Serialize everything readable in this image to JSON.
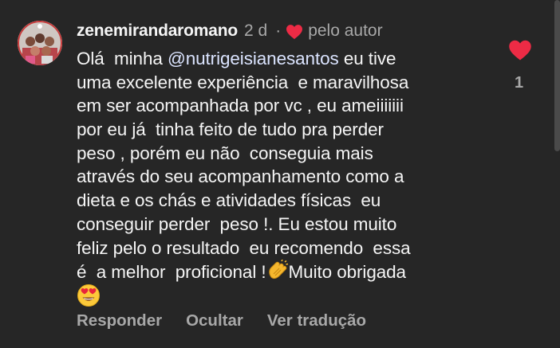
{
  "comment": {
    "username": "zenemirandaromano",
    "time_ago": "2 d",
    "separator": "·",
    "liked_by_author_label": "pelo autor",
    "mention": "@nutrigeisianesantos",
    "lines": [
      {
        "before": "Olá  minha ",
        "after": " eu tive"
      },
      {
        "text": "uma excelente experiência  e maravilhosa"
      },
      {
        "text": "em ser acompanhada por vc , eu ameiiiiiii"
      },
      {
        "text": "por eu já  tinha feito de tudo pra perder"
      },
      {
        "text": "peso , porém eu não  conseguia mais"
      },
      {
        "text": "através do seu acompanhamento como a"
      },
      {
        "text": "dieta e os chás e atividades físicas  eu"
      },
      {
        "text": "conseguir perder  peso !. Eu estou muito"
      },
      {
        "text": "feliz pelo o resultado  eu recomendo  essa"
      },
      {
        "before": "é  a melhor  proficional !",
        "after": "Muito obrigada"
      }
    ],
    "emojis": {
      "clapping": "clapping-hands-emoji",
      "heart_eyes": "heart-eyes-emoji"
    },
    "like_count": "1",
    "actions": {
      "reply": "Responder",
      "hide": "Ocultar",
      "translate": "Ver tradução"
    }
  },
  "icons": {
    "like": "heart-icon",
    "author_like": "heart-icon"
  },
  "colors": {
    "background": "#262626",
    "primary_text": "#f5f5f5",
    "secondary_text": "#a8a8a8",
    "mention": "#dbe4ff",
    "heart": "#ed2b45"
  }
}
